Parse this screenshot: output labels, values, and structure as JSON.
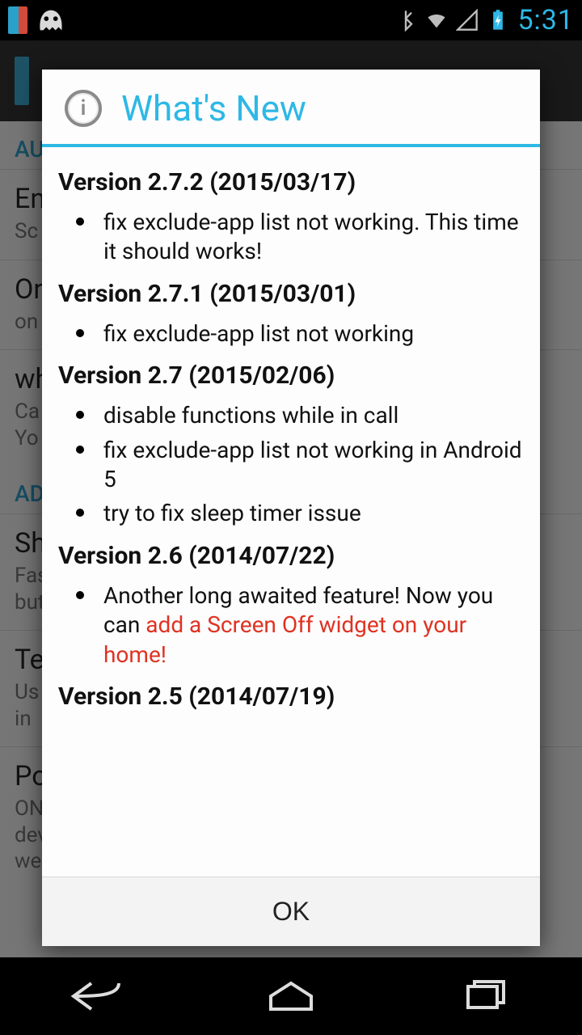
{
  "statusbar": {
    "time": "5:31"
  },
  "bg": {
    "section1": "AU",
    "row1": {
      "title": "En",
      "sub": "Sc"
    },
    "row2": {
      "title": "On",
      "sub": "on"
    },
    "row3": {
      "title": "wh",
      "sub": "Ca\nYo"
    },
    "section2": "AD",
    "row4": {
      "title": "Sh",
      "sub": "Fas\nbut"
    },
    "row5": {
      "title": "Te",
      "sub": "Us\nin"
    },
    "row6": {
      "title": "Po",
      "sub": "ON\ndev\nwe"
    }
  },
  "dialog": {
    "title": "What's New",
    "ok": "OK",
    "versions": [
      {
        "header": "Version 2.7.2 (2015/03/17)",
        "items": [
          {
            "text": "fix exclude-app list not working. This time it should works!"
          }
        ]
      },
      {
        "header": "Version 2.7.1 (2015/03/01)",
        "items": [
          {
            "text": "fix exclude-app list not working"
          }
        ]
      },
      {
        "header": "Version 2.7 (2015/02/06)",
        "items": [
          {
            "text": "disable functions while in call"
          },
          {
            "text": "fix exclude-app list not working in Android 5"
          },
          {
            "text": "try to fix sleep timer issue"
          }
        ]
      },
      {
        "header": "Version 2.6 (2014/07/22)",
        "items": [
          {
            "text": "Another long awaited feature! Now you can ",
            "red": "add a Screen Off widget on your home!"
          }
        ]
      },
      {
        "header": "Version 2.5 (2014/07/19)",
        "items": []
      }
    ]
  }
}
